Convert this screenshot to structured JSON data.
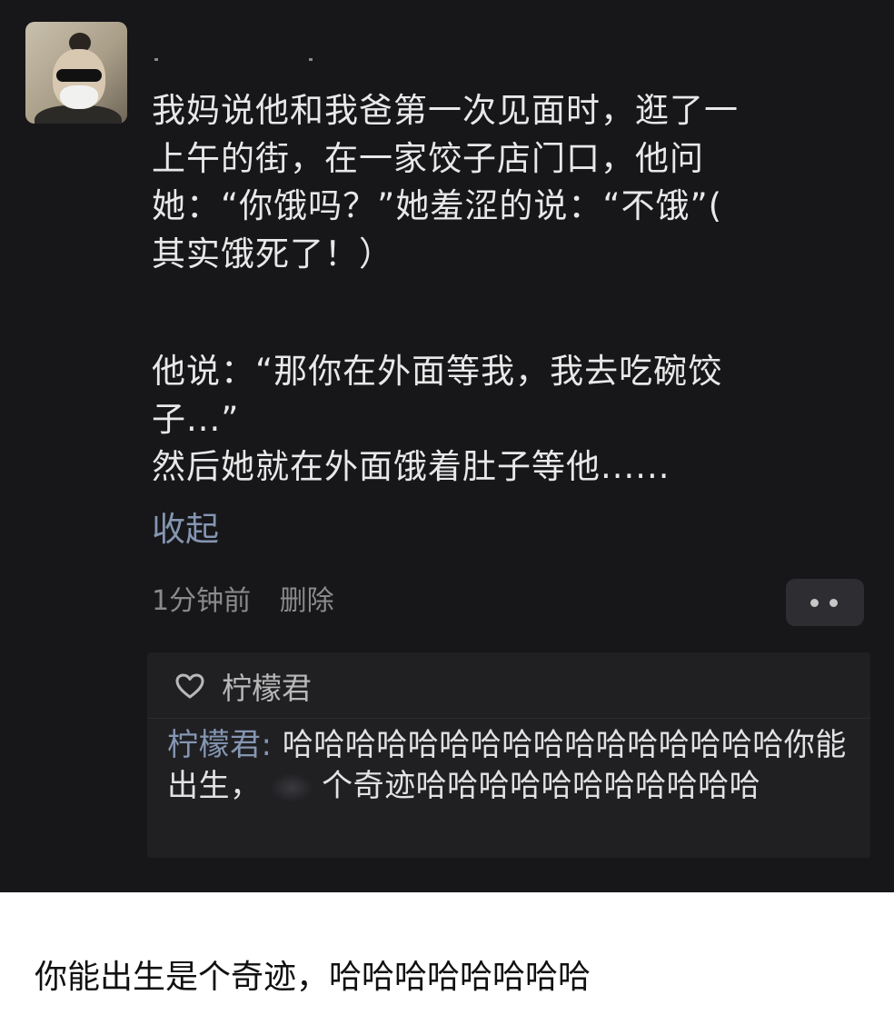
{
  "post": {
    "lines": [
      "我妈说他和我爸第一次见面时，逛了一",
      "上午的街，在一家饺子店门口，他问",
      "她：“你饿吗？”她羞涩的说：“不饿”(",
      "其实饿死了！）"
    ],
    "lines2": [
      "他说：“那你在外面等我，我去吃碗饺",
      "子...”",
      "然后她就在外面饿着肚子等他......"
    ],
    "collapse_label": "收起",
    "time_label": "1分钟前",
    "delete_label": "删除",
    "more_icon": "more-dots-icon"
  },
  "likes": {
    "icon": "heart-icon",
    "name": "柠檬君"
  },
  "reply": {
    "author": "柠檬君:",
    "text_before": "哈哈哈哈哈哈哈哈哈哈哈哈哈哈哈哈你能出生，",
    "text_after": "个奇迹哈哈哈哈哈哈哈哈哈哈哈"
  },
  "caption": "你能出生是个奇迹，哈哈哈哈哈哈哈哈",
  "colors": {
    "background": "#17171a",
    "link": "#8596b2",
    "text": "#e8e8e8",
    "muted": "#8a8a8a",
    "caption_bg": "#ffffff"
  }
}
